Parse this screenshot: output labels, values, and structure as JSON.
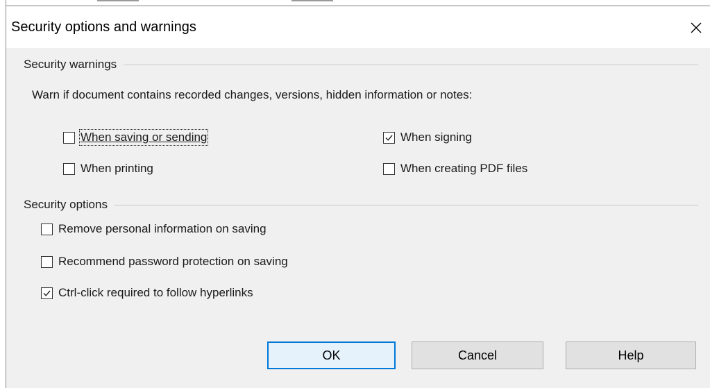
{
  "dialog": {
    "title": "Security options and warnings"
  },
  "warnings": {
    "header": "Security warnings",
    "description": "Warn if document contains recorded changes, versions, hidden information or notes:",
    "checkboxes": [
      {
        "id": "saving",
        "label": "When saving or sending",
        "checked": false,
        "focused": true
      },
      {
        "id": "signing",
        "label": "When signing",
        "checked": true
      },
      {
        "id": "printing",
        "label": "When printing",
        "checked": false
      },
      {
        "id": "pdf",
        "label": "When creating PDF files",
        "checked": false
      }
    ]
  },
  "options": {
    "header": "Security options",
    "checkboxes": [
      {
        "id": "remove_personal",
        "label": "Remove personal information on saving",
        "checked": false
      },
      {
        "id": "recommend_password",
        "label": "Recommend password protection on saving",
        "checked": false
      },
      {
        "id": "ctrl_click",
        "label": "Ctrl-click required to follow hyperlinks",
        "checked": true
      }
    ]
  },
  "buttons": {
    "ok": "OK",
    "cancel": "Cancel",
    "help": "Help"
  },
  "colors": {
    "default_button_border": "#0078d7",
    "dialog_background": "#f0f0f0"
  }
}
